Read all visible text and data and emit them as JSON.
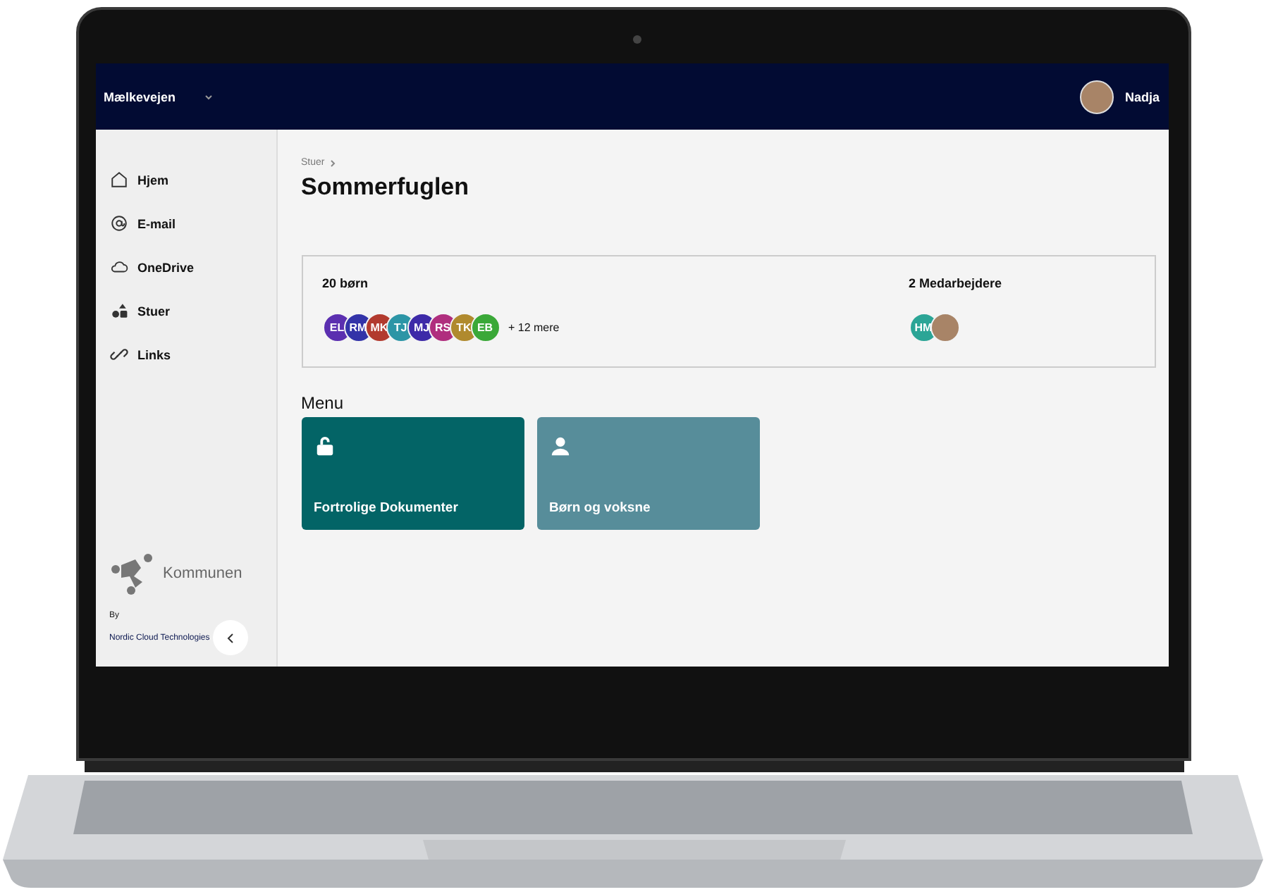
{
  "topbar": {
    "org": "Mælkevejen",
    "user": "Nadja"
  },
  "sidebar": {
    "items": [
      {
        "label": "Hjem",
        "kind": "home"
      },
      {
        "label": "E-mail",
        "kind": "at"
      },
      {
        "label": "OneDrive",
        "kind": "cloud"
      },
      {
        "label": "Stuer",
        "kind": "shapes"
      },
      {
        "label": "Links",
        "kind": "link"
      }
    ],
    "logo_text": "Kommunen",
    "by": "By",
    "company": "Nordic Cloud Technologies"
  },
  "breadcrumb": "Stuer",
  "title": "Sommerfuglen",
  "children": {
    "heading": "20 børn",
    "more": "+ 12 mere",
    "avatars": [
      {
        "kind": "initials",
        "initials": "EL",
        "color": "#5b2fb0"
      },
      {
        "kind": "initials",
        "initials": "RM",
        "color": "#3333a8"
      },
      {
        "kind": "initials",
        "initials": "MK",
        "color": "#b23a2e"
      },
      {
        "kind": "initials",
        "initials": "TJ",
        "color": "#2c95a6"
      },
      {
        "kind": "initials",
        "initials": "MJ",
        "color": "#3d2aa8"
      },
      {
        "kind": "initials",
        "initials": "RS",
        "color": "#b02e7e"
      },
      {
        "kind": "initials",
        "initials": "TK",
        "color": "#b08a2e"
      },
      {
        "kind": "initials",
        "initials": "EB",
        "color": "#3aa838"
      }
    ]
  },
  "staff": {
    "heading": "2 Medarbejdere",
    "avatars": [
      {
        "kind": "initials",
        "initials": "HM",
        "color": "#2ba596"
      },
      {
        "kind": "photo"
      }
    ]
  },
  "menu": {
    "heading": "Menu",
    "tiles": [
      {
        "label": "Fortrolige Dokumenter",
        "kind": "lock",
        "color": "#036466"
      },
      {
        "label": "Børn og voksne",
        "kind": "person",
        "color": "#578d9a"
      }
    ]
  }
}
